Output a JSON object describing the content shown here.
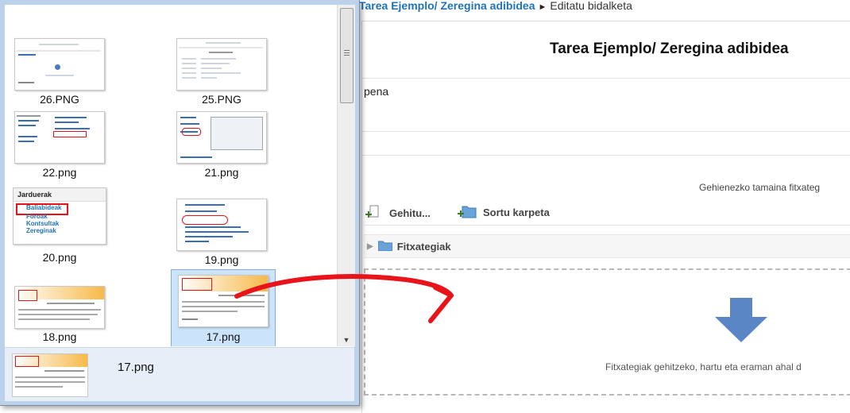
{
  "breadcrumb": {
    "link": "Tarea Ejemplo/ Zeregina adibidea",
    "separator": "►",
    "current": "Editatu bidalketa"
  },
  "page": {
    "title": "Tarea Ejemplo/ Zeregina adibidea",
    "field_label": "pena",
    "max_size_text": "Gehienezko tamaina fitxateg",
    "toolbar": {
      "add_label": "Gehitu...",
      "create_folder_label": "Sortu karpeta"
    },
    "path_label": "Fitxategiak",
    "drop_text": "Fitxategiak gehitzeko, hartu eta eraman ahal d"
  },
  "explorer": {
    "files": [
      {
        "name": "26.PNG"
      },
      {
        "name": "25.PNG"
      },
      {
        "name": "22.png"
      },
      {
        "name": "21.png"
      },
      {
        "name": "20.png"
      },
      {
        "name": "19.png"
      },
      {
        "name": "18.png"
      },
      {
        "name": "17.png",
        "selected": true
      }
    ],
    "thumb_20": {
      "header": "Jarduerak",
      "items": [
        "Baliabideak",
        "Foroak",
        "Kontsultak",
        "Zereginak"
      ]
    },
    "details_name": "17.png"
  },
  "colors": {
    "link": "#1f73b7",
    "selection": "#cce4fb",
    "annotation_arrow": "#e8141a",
    "drop_arrow": "#5b86c6"
  }
}
